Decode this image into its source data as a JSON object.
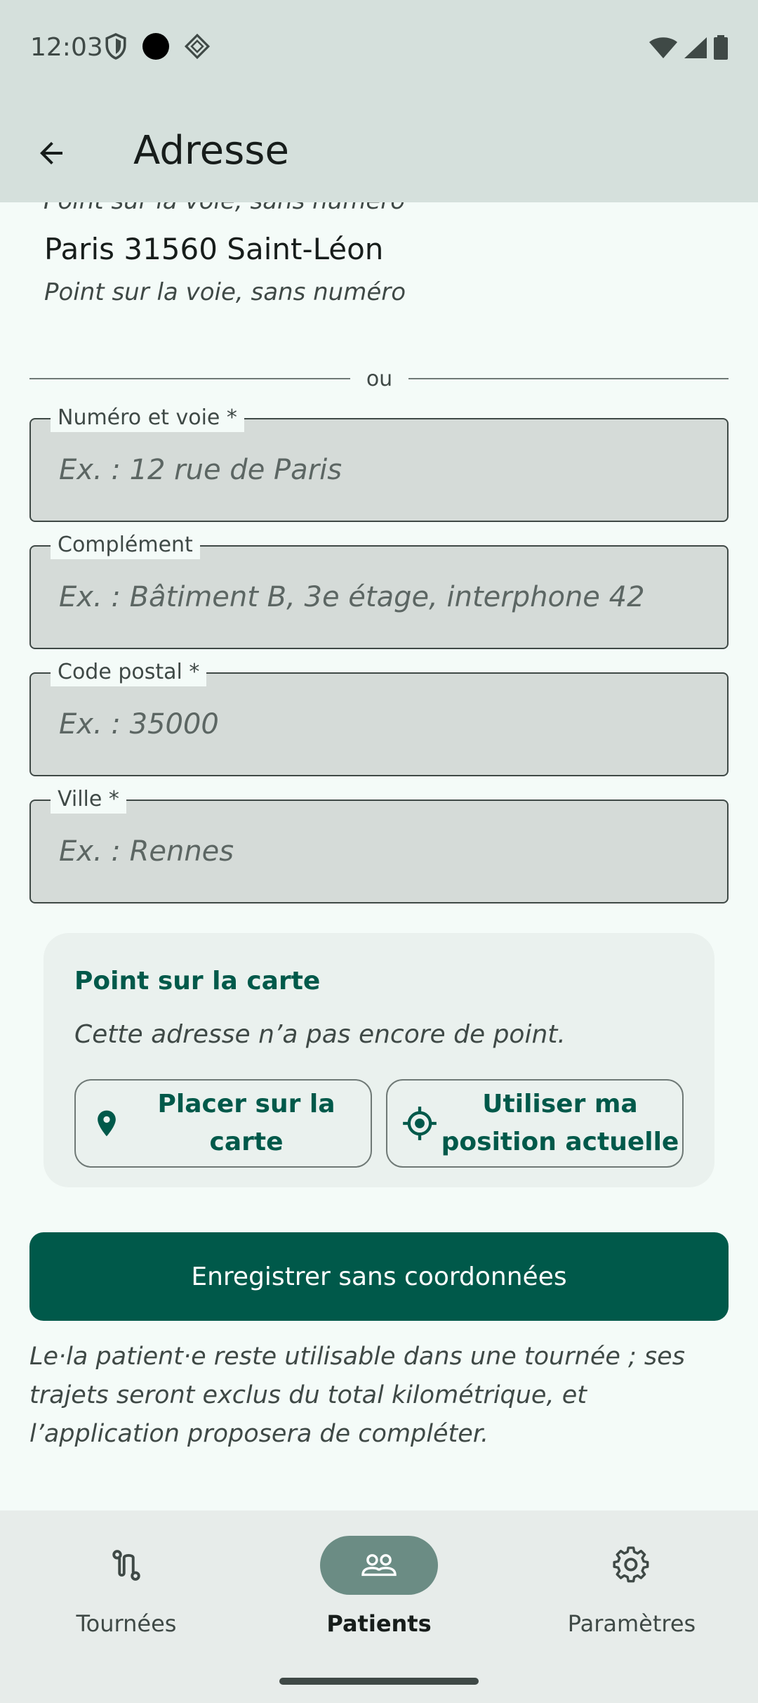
{
  "status_bar": {
    "time": "12:03"
  },
  "app_bar": {
    "title": "Adresse"
  },
  "result": {
    "cut_off_text": "Point sur la voie, sans numéro",
    "title": "Paris 31560 Saint-Léon",
    "subtitle": "Point sur la voie, sans numéro"
  },
  "divider_text": "ou",
  "form": {
    "street": {
      "label": "Numéro et voie *",
      "placeholder": "Ex. : 12 rue de Paris",
      "value": ""
    },
    "complement": {
      "label": "Complément",
      "placeholder": "Ex. : Bâtiment B, 3e étage, interphone 42",
      "value": ""
    },
    "postal_code": {
      "label": "Code postal *",
      "placeholder": "Ex. : 35000",
      "value": ""
    },
    "city": {
      "label": "Ville *",
      "placeholder": "Ex. : Rennes",
      "value": ""
    }
  },
  "map_card": {
    "title": "Point sur la carte",
    "text": "Cette adresse n’a pas encore de point.",
    "place_button": "Placer sur la carte",
    "current_position_line1": "Utiliser ma",
    "current_position_line2": "position actuelle"
  },
  "save_button": "Enregistrer sans coordonnées",
  "help_text": "Le·la patient·e reste utilisable dans une tournée ; ses trajets seront exclus du total kilométrique, et l’application proposera de compléter.",
  "bottom_nav": {
    "items": [
      {
        "label": "Tournées",
        "icon": "route-icon",
        "active": false
      },
      {
        "label": "Patients",
        "icon": "people-icon",
        "active": true
      },
      {
        "label": "Paramètres",
        "icon": "gear-icon",
        "active": false
      }
    ]
  },
  "colors": {
    "primary": "#00594a",
    "app_bar": "#d5e0dc",
    "background": "#f4fbf8",
    "field_fill": "#d5dbd8",
    "active_pill": "#6b8c84"
  }
}
